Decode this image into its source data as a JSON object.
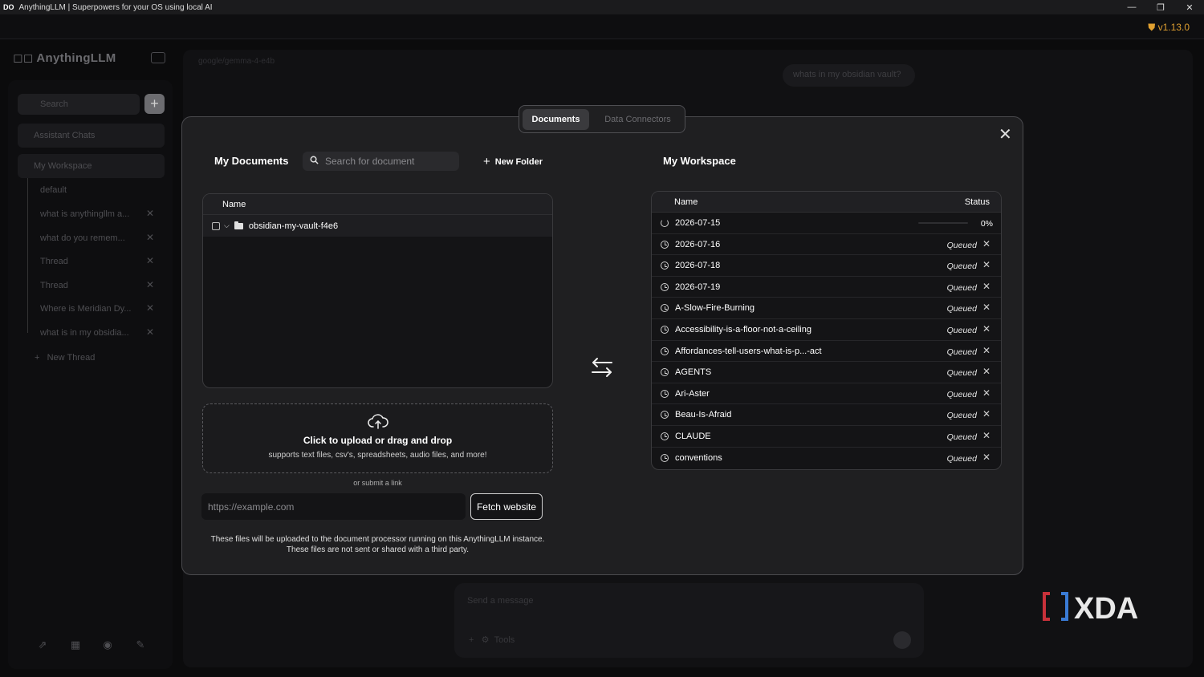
{
  "window": {
    "title": "AnythingLLM | Superpowers for your OS using local AI",
    "logo": "DO",
    "minimize": "—",
    "maximize": "❐",
    "close": "✕"
  },
  "version": "v1.13.0",
  "sidebar": {
    "brand": "AnythingLLM",
    "search_placeholder": "Search",
    "new_button": "+",
    "assistant_chats": "Assistant Chats",
    "workspace": "My Workspace",
    "threads": [
      {
        "label": "default",
        "closable": false
      },
      {
        "label": "what is anythingllm a...",
        "closable": true
      },
      {
        "label": "what do you remem...",
        "closable": true
      },
      {
        "label": "Thread",
        "closable": true
      },
      {
        "label": "Thread",
        "closable": true
      },
      {
        "label": "Where is Meridian Dy...",
        "closable": true
      },
      {
        "label": "what is in my obsidia...",
        "closable": true
      }
    ],
    "new_thread": "New Thread"
  },
  "main": {
    "model_label": "google/gemma-4-e4b",
    "user_message": "whats in my obsidian vault?",
    "composer_placeholder": "Send a message",
    "tools_label": "Tools"
  },
  "modal": {
    "tabs": {
      "documents": "Documents",
      "connectors": "Data Connectors"
    },
    "close_glyph": "✕",
    "my_documents": {
      "title": "My Documents",
      "search_placeholder": "Search for document",
      "new_folder": "New Folder",
      "column_name": "Name",
      "folders": [
        {
          "name": "obsidian-my-vault-f4e6"
        }
      ]
    },
    "upload": {
      "title": "Click to upload or drag and drop",
      "subtitle": "supports text files, csv's, spreadsheets, audio files, and more!",
      "or_link": "or submit a link",
      "url_placeholder": "https://example.com",
      "fetch_button": "Fetch website",
      "disclaimer_1": "These files will be uploaded to the document processor running on this AnythingLLM instance.",
      "disclaimer_2": "These files are not sent or shared with a third party."
    },
    "workspace": {
      "title": "My Workspace",
      "column_name": "Name",
      "column_status": "Status",
      "rows": [
        {
          "name": "2026-07-15",
          "status": "0%",
          "progress": 0
        },
        {
          "name": "2026-07-16",
          "status": "Queued"
        },
        {
          "name": "2026-07-18",
          "status": "Queued"
        },
        {
          "name": "2026-07-19",
          "status": "Queued"
        },
        {
          "name": "A-Slow-Fire-Burning",
          "status": "Queued"
        },
        {
          "name": "Accessibility-is-a-floor-not-a-ceiling",
          "status": "Queued"
        },
        {
          "name": "Affordances-tell-users-what-is-p...-act",
          "status": "Queued"
        },
        {
          "name": "AGENTS",
          "status": "Queued"
        },
        {
          "name": "Ari-Aster",
          "status": "Queued"
        },
        {
          "name": "Beau-Is-Afraid",
          "status": "Queued"
        },
        {
          "name": "CLAUDE",
          "status": "Queued"
        },
        {
          "name": "conventions",
          "status": "Queued"
        }
      ]
    }
  },
  "watermark": "XDA",
  "colors": {
    "accent_version": "#e0a030",
    "modal_bg": "#1f1f21",
    "xda_red": "#c8313a"
  }
}
